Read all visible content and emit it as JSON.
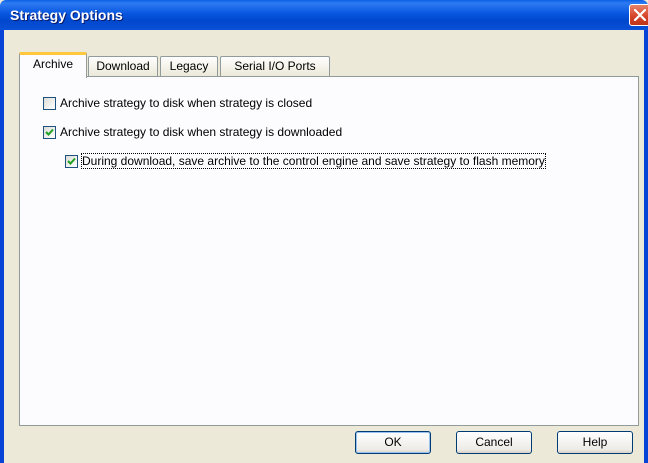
{
  "window": {
    "title": "Strategy Options"
  },
  "tabs": [
    {
      "label": "Archive"
    },
    {
      "label": "Download"
    },
    {
      "label": "Legacy"
    },
    {
      "label": "Serial I/O Ports"
    }
  ],
  "options": [
    {
      "label": "Archive strategy to disk when strategy is closed",
      "checked": false
    },
    {
      "label": "Archive strategy to disk when strategy is downloaded",
      "checked": true
    },
    {
      "label": "During download, save archive to the control engine and save strategy to flash memory",
      "checked": true
    }
  ],
  "buttons": {
    "ok": "OK",
    "cancel": "Cancel",
    "help": "Help"
  },
  "icons": {
    "close": "close-icon",
    "check": "checkmark-icon"
  },
  "colors": {
    "title_bar": "#0054e3",
    "check": "#21a121",
    "active_tab_accent": "#ffc83c"
  }
}
